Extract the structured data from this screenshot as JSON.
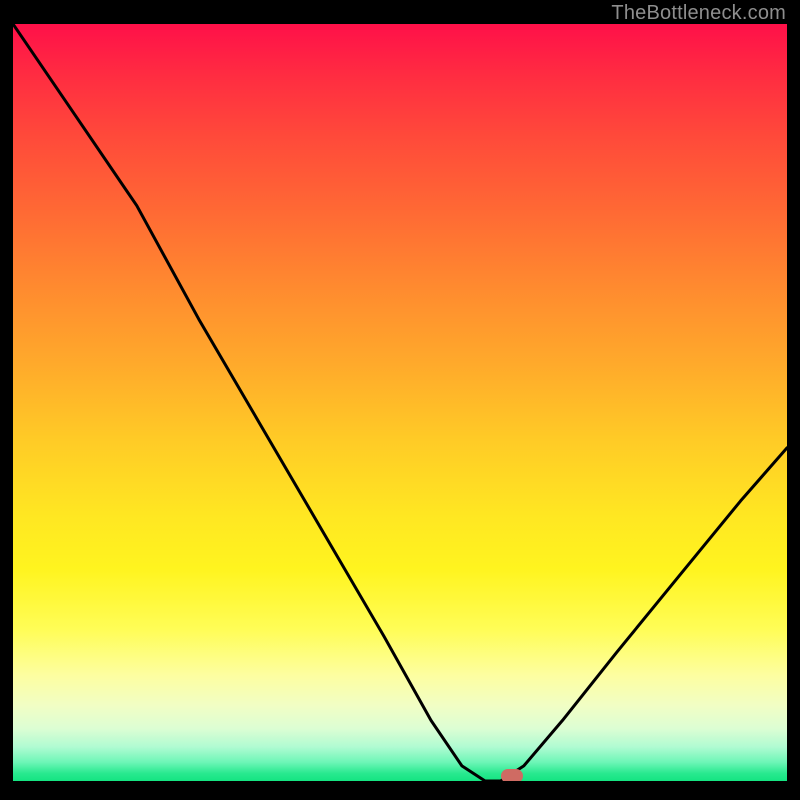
{
  "watermark": "TheBottleneck.com",
  "chart_data": {
    "type": "line",
    "title": "",
    "xlabel": "",
    "ylabel": "",
    "xlim": [
      0,
      100
    ],
    "ylim": [
      0,
      100
    ],
    "grid": false,
    "series": [
      {
        "name": "bottleneck-curve",
        "x": [
          0,
          8,
          16,
          24,
          32,
          40,
          48,
          54,
          58,
          61,
          63,
          66,
          71,
          78,
          86,
          94,
          100
        ],
        "values": [
          100,
          88,
          76,
          61,
          47,
          33,
          19,
          8,
          2,
          0,
          0,
          2,
          8,
          17,
          27,
          37,
          44
        ]
      }
    ],
    "marker": {
      "x": 64.5,
      "y": 0.6
    },
    "gradient_stops": [
      {
        "pos": 0,
        "color": "#ff1049"
      },
      {
        "pos": 25,
        "color": "#ff6a34"
      },
      {
        "pos": 55,
        "color": "#ffcb26"
      },
      {
        "pos": 80,
        "color": "#fffd57"
      },
      {
        "pos": 95,
        "color": "#b0fbd2"
      },
      {
        "pos": 100,
        "color": "#14e481"
      }
    ]
  }
}
